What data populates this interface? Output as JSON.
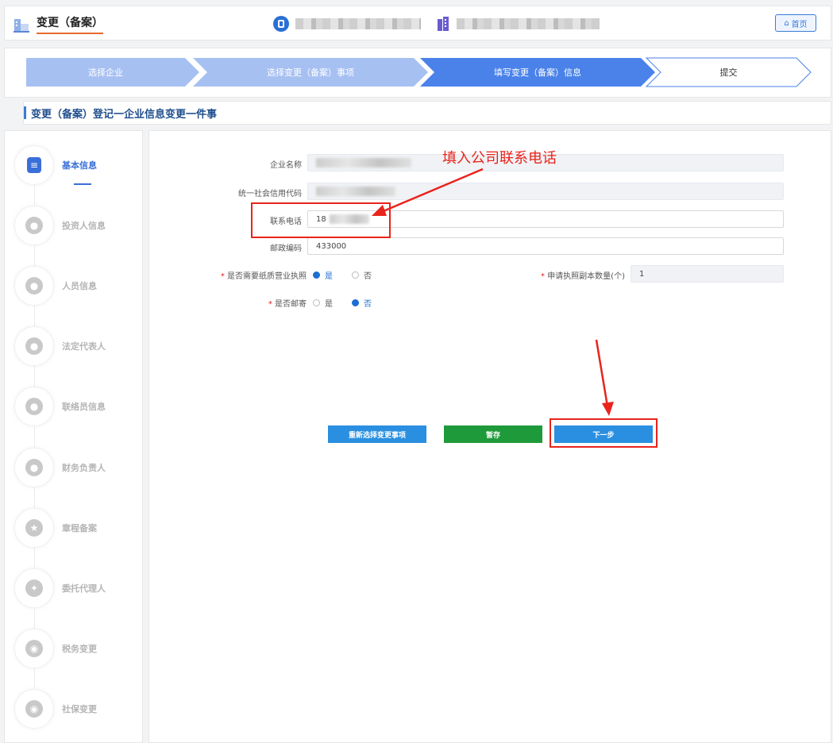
{
  "header": {
    "app_title": "变更（备案）",
    "home_label": "首页",
    "icons": [
      "app-logo-icon",
      "user-badge-icon",
      "building-icon",
      "home-icon"
    ]
  },
  "steps": [
    {
      "label": "选择企业",
      "state": "done"
    },
    {
      "label": "选择变更（备案）事项",
      "state": "done"
    },
    {
      "label": "填写变更（备案）信息",
      "state": "current"
    },
    {
      "label": "提交",
      "state": "todo"
    }
  ],
  "section_title": "变更（备案）登记一企业信息变更一件事",
  "sidebar": {
    "items": [
      {
        "label": "基本信息",
        "icon": "document-icon",
        "active": true
      },
      {
        "label": "投资人信息",
        "icon": "investor-icon",
        "active": false
      },
      {
        "label": "人员信息",
        "icon": "people-icon",
        "active": false
      },
      {
        "label": "法定代表人",
        "icon": "legal-person-icon",
        "active": false
      },
      {
        "label": "联络员信息",
        "icon": "liaison-icon",
        "active": false
      },
      {
        "label": "财务负责人",
        "icon": "finance-person-icon",
        "active": false
      },
      {
        "label": "章程备案",
        "icon": "shield-icon",
        "active": false
      },
      {
        "label": "委托代理人",
        "icon": "handshake-icon",
        "active": false
      },
      {
        "label": "税务变更",
        "icon": "tax-icon",
        "active": false
      },
      {
        "label": "社保变更",
        "icon": "social-security-icon",
        "active": false
      }
    ]
  },
  "form": {
    "company_name_label": "企业名称",
    "credit_code_label": "统一社会信用代码",
    "phone_label": "联系电话",
    "phone_value": "18",
    "postal_label": "邮政编码",
    "postal_value": "433000",
    "paper_license_label": "是否需要纸质营业执照",
    "paper_license_options": [
      "是",
      "否"
    ],
    "paper_license_selected": "是",
    "copies_label": "申请执照副本数量(个)",
    "copies_value": "1",
    "mail_label": "是否邮寄",
    "mail_options": [
      "是",
      "否"
    ],
    "mail_selected": "否",
    "required_mark": "*"
  },
  "buttons": {
    "reselect": "重新选择变更事项",
    "save": "暂存",
    "next": "下一步"
  },
  "annotation": {
    "text": "填入公司联系电话"
  },
  "colors": {
    "primary": "#3a6fd8",
    "step_done": "#a7c0f2",
    "step_current": "#4a82ea",
    "save_green": "#1f9a3a",
    "button_blue": "#2a8fe0",
    "annotation_red": "#e8241c"
  }
}
